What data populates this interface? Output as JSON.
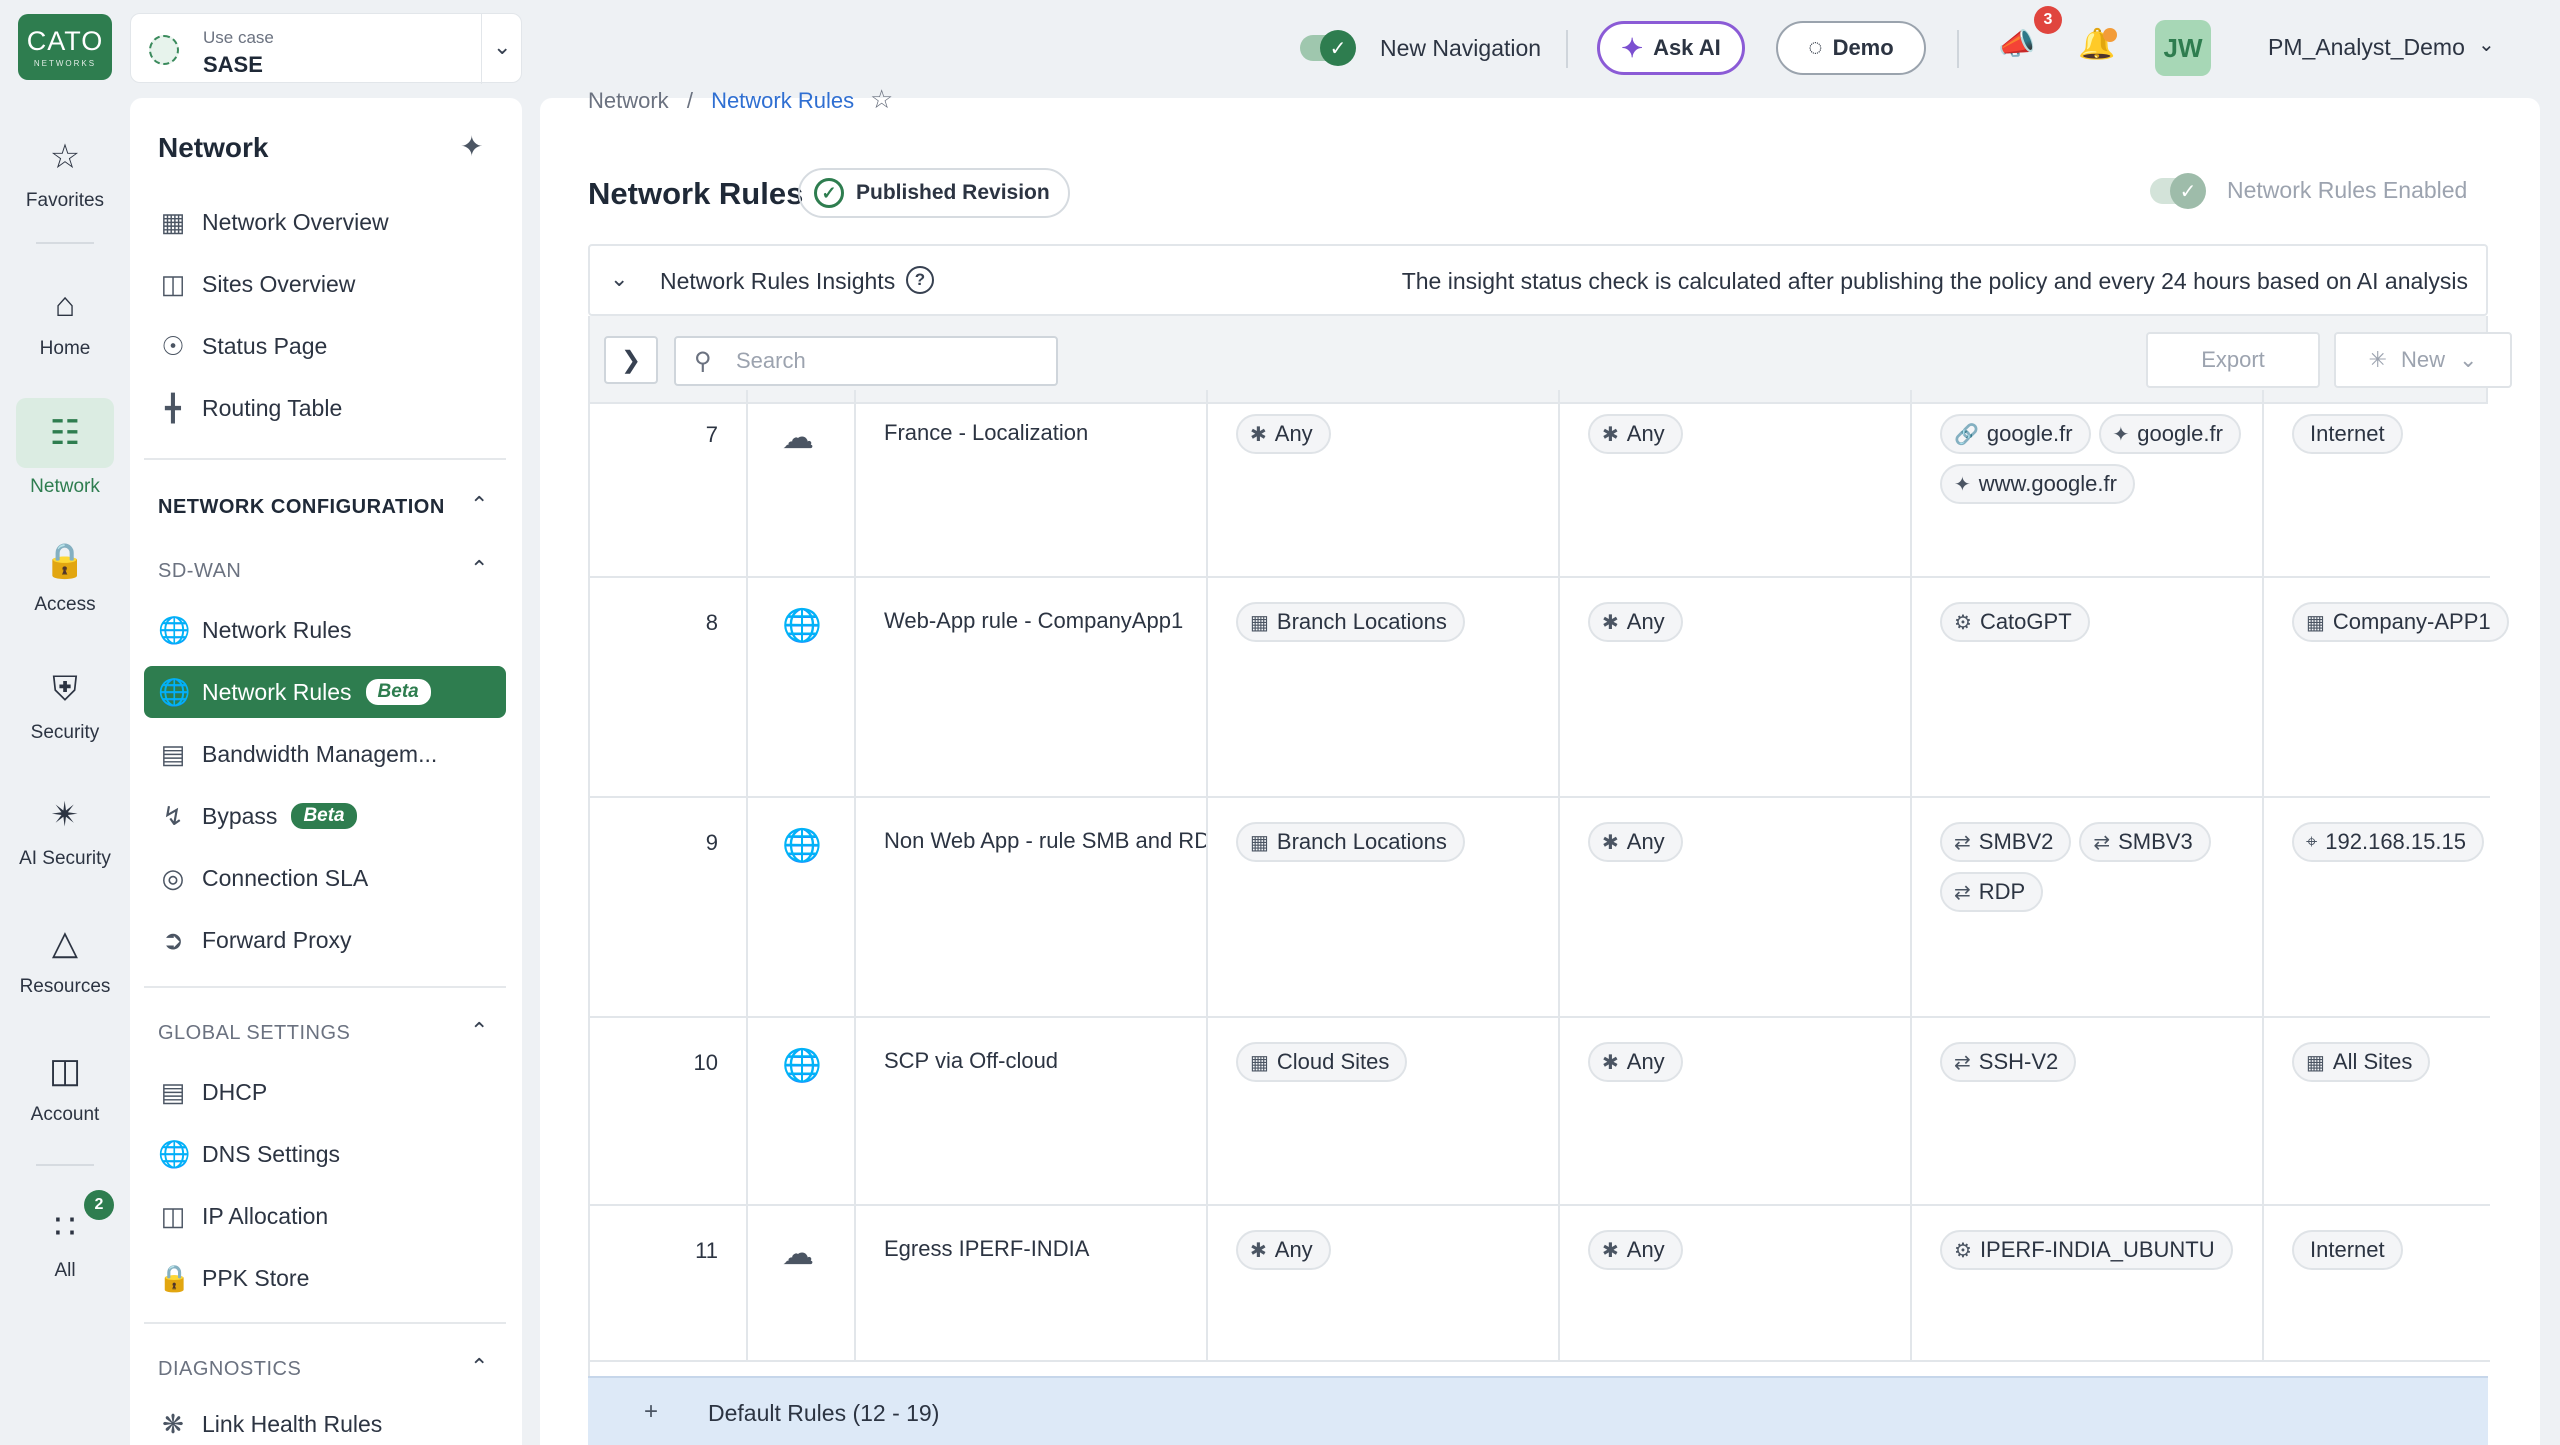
{
  "brand": {
    "logo_main": "CATO",
    "logo_sub": "NETWORKS"
  },
  "usecase": {
    "label": "Use case",
    "value": "SASE"
  },
  "topbar": {
    "new_navigation": "New Navigation",
    "ask_ai": "Ask AI",
    "demo": "Demo",
    "announcements_count": "3",
    "avatar_initials": "JW",
    "user": "PM_Analyst_Demo"
  },
  "rail": {
    "favorites": "Favorites",
    "home": "Home",
    "network": "Network",
    "access": "Access",
    "security": "Security",
    "ai_security": "AI Security",
    "resources": "Resources",
    "account": "Account",
    "all": "All",
    "all_badge": "2"
  },
  "sidebar": {
    "title": "Network",
    "top_items": [
      "Network Overview",
      "Sites Overview",
      "Status Page",
      "Routing Table"
    ],
    "section_network_config": "NETWORK CONFIGURATION",
    "sub_sdwan": "SD-WAN",
    "sdwan_items": {
      "network_rules": "Network Rules",
      "network_rules_beta": "Network Rules",
      "bandwidth": "Bandwidth Managem...",
      "bypass": "Bypass",
      "connection_sla": "Connection SLA",
      "forward_proxy": "Forward Proxy"
    },
    "beta_label": "Beta",
    "section_global": "GLOBAL SETTINGS",
    "global_items": [
      "DHCP",
      "DNS Settings",
      "IP Allocation",
      "PPK Store"
    ],
    "section_diag": "DIAGNOSTICS",
    "diag_items": [
      "Link Health Rules"
    ]
  },
  "main": {
    "breadcrumb_root": "Network",
    "breadcrumb_sep": "/",
    "breadcrumb_current": "Network Rules",
    "title": "Network Rules",
    "published_badge": "Published Revision",
    "enabled_label": "Network Rules Enabled",
    "insights_title": "Network Rules Insights",
    "insights_msg": "The insight status check is calculated after publishing the policy and every 24 hours based on AI analysis",
    "search_placeholder": "Search",
    "export": "Export",
    "new": "New",
    "default_rules": "Default Rules (12 - 19)"
  },
  "rules": [
    {
      "num": "7",
      "icon": "cloud-icon",
      "name": "France - Localization",
      "source": [
        {
          "t": "Any",
          "i": "asterisk"
        }
      ],
      "dest": [
        {
          "t": "Any",
          "i": "asterisk"
        }
      ],
      "app": [
        {
          "t": "google.fr",
          "i": "link"
        },
        {
          "t": "google.fr",
          "i": "sparkle"
        },
        {
          "t": "www.google.fr",
          "i": "sparkle"
        }
      ],
      "via": [
        {
          "t": "Internet",
          "i": ""
        }
      ]
    },
    {
      "num": "8",
      "icon": "globe-icon",
      "name": "Web-App rule - CompanyApp1",
      "source": [
        {
          "t": "Branch Locations",
          "i": "grid"
        }
      ],
      "dest": [
        {
          "t": "Any",
          "i": "asterisk"
        }
      ],
      "app": [
        {
          "t": "CatoGPT",
          "i": "gear"
        }
      ],
      "via": [
        {
          "t": "Company-APP1",
          "i": "grid"
        }
      ]
    },
    {
      "num": "9",
      "icon": "globe-icon",
      "name": "Non Web App - rule SMB and RDP",
      "source": [
        {
          "t": "Branch Locations",
          "i": "grid"
        }
      ],
      "dest": [
        {
          "t": "Any",
          "i": "asterisk"
        }
      ],
      "app": [
        {
          "t": "SMBV2",
          "i": "proto"
        },
        {
          "t": "SMBV3",
          "i": "proto"
        },
        {
          "t": "RDP",
          "i": "proto"
        }
      ],
      "via": [
        {
          "t": "192.168.15.15",
          "i": "pin"
        }
      ]
    },
    {
      "num": "10",
      "icon": "globe-icon",
      "name": "SCP via Off-cloud",
      "source": [
        {
          "t": "Cloud Sites",
          "i": "grid"
        }
      ],
      "dest": [
        {
          "t": "Any",
          "i": "asterisk"
        }
      ],
      "app": [
        {
          "t": "SSH-V2",
          "i": "proto"
        }
      ],
      "via": [
        {
          "t": "All Sites",
          "i": "grid"
        }
      ]
    },
    {
      "num": "11",
      "icon": "cloud-icon",
      "name": "Egress IPERF-INDIA",
      "source": [
        {
          "t": "Any",
          "i": "asterisk"
        }
      ],
      "dest": [
        {
          "t": "Any",
          "i": "asterisk"
        }
      ],
      "app": [
        {
          "t": "IPERF-INDIA_UBUNTU",
          "i": "gear"
        }
      ],
      "via": [
        {
          "t": "Internet",
          "i": ""
        }
      ]
    }
  ],
  "colors": {
    "brand": "#2e7d4f",
    "link": "#2f6fd2",
    "ask_ai_border": "#8b5bd6",
    "badge": "#e0453e"
  }
}
